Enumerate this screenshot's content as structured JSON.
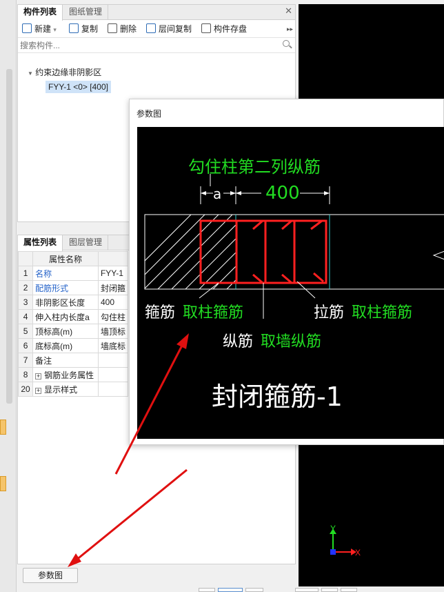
{
  "component_panel": {
    "tabs": [
      "构件列表",
      "图纸管理"
    ],
    "toolbar": {
      "new": "新建",
      "copy": "复制",
      "delete": "删除",
      "floor_copy": "层间复制",
      "save": "构件存盘"
    },
    "search_placeholder": "搜索构件...",
    "tree": {
      "group": "约束边缘非阴影区",
      "item": "FYY-1 <0> [400]"
    }
  },
  "property_panel": {
    "tabs": [
      "属性列表",
      "图层管理"
    ],
    "header": "属性名称",
    "rows": [
      {
        "num": "1",
        "name": "名称",
        "value": "FYY-1"
      },
      {
        "num": "2",
        "name": "配筋形式",
        "value": "封闭箍"
      },
      {
        "num": "3",
        "name": "非阴影区长度",
        "value": "400"
      },
      {
        "num": "4",
        "name": "伸入柱内长度a",
        "value": "勾住柱"
      },
      {
        "num": "5",
        "name": "顶标高(m)",
        "value": "墙顶标"
      },
      {
        "num": "6",
        "name": "底标高(m)",
        "value": "墙底标"
      },
      {
        "num": "7",
        "name": "备注",
        "value": ""
      },
      {
        "num": "8",
        "name": "钢筋业务属性",
        "value": ""
      },
      {
        "num": "20",
        "name": "显示样式",
        "value": ""
      }
    ]
  },
  "param_button": "参数图",
  "popup": {
    "title": "参数图",
    "diagram": {
      "top_label": "勾住柱第二列纵筋",
      "dim_a": "a",
      "dim_400": "400",
      "label_stirrup": "箍筋",
      "label_stirrup_green": "取柱箍筋",
      "label_tie": "拉筋",
      "label_tie_green": "取柱箍筋",
      "label_long": "纵筋",
      "label_long_green": "取墙纵筋",
      "caption": "封闭箍筋-1"
    }
  },
  "axes": {
    "y": "Y",
    "x": "X"
  },
  "colors": {
    "accent_blue": "#2563c9",
    "rebar_red": "#ff2020",
    "label_green": "#22dd22",
    "arrow_red": "#e01010"
  }
}
